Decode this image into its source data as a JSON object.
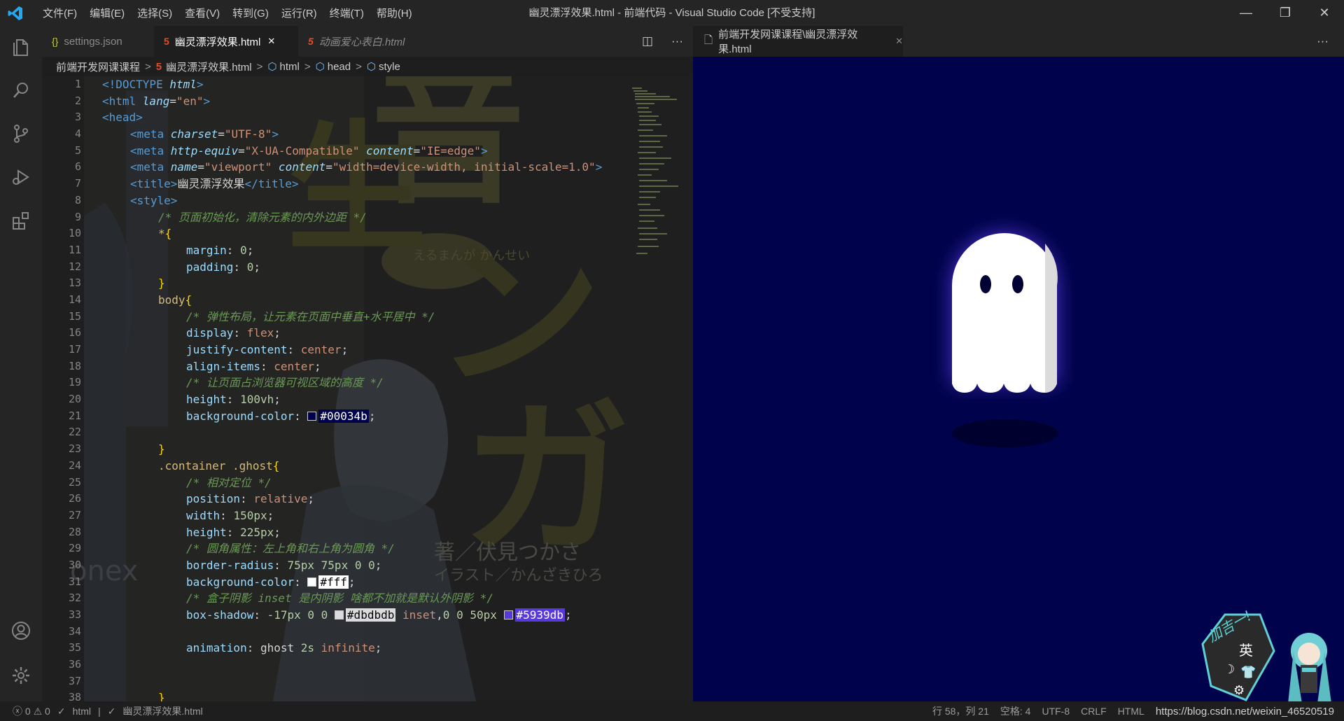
{
  "window": {
    "title": "幽灵漂浮效果.html - 前端代码 - Visual Studio Code [不受支持]",
    "controls": {
      "minimize": "—",
      "maximize": "❐",
      "close": "✕"
    }
  },
  "menu": [
    "文件(F)",
    "编辑(E)",
    "选择(S)",
    "查看(V)",
    "转到(G)",
    "运行(R)",
    "终端(T)",
    "帮助(H)"
  ],
  "activity_bar": [
    "files-icon",
    "search-icon",
    "source-control-icon",
    "run-debug-icon",
    "extensions-icon",
    "account-icon",
    "settings-gear-icon"
  ],
  "tabs": [
    {
      "label": "settings.json",
      "icon": "{}",
      "state": "inactive"
    },
    {
      "label": "幽灵漂浮效果.html",
      "icon": "5",
      "state": "active",
      "close": "✕"
    },
    {
      "label": "动画爱心表白.html",
      "icon": "5",
      "state": "inactive"
    }
  ],
  "tab_actions": {
    "split": "◫",
    "more": "···"
  },
  "breadcrumb": [
    "前端开发网课课程",
    "幽灵漂浮效果.html",
    "html",
    "head",
    "style"
  ],
  "line_numbers": [
    "1",
    "2",
    "3",
    "4",
    "5",
    "6",
    "7",
    "8",
    "9",
    "10",
    "11",
    "12",
    "13",
    "14",
    "15",
    "16",
    "17",
    "18",
    "19",
    "20",
    "21",
    "22",
    "23",
    "24",
    "25",
    "26",
    "27",
    "28",
    "29",
    "30",
    "31",
    "32",
    "33",
    "34",
    "35",
    "36",
    "37",
    "38"
  ],
  "code": {
    "l1_a": "<!DOCTYPE ",
    "l1_b": "html",
    "l1_c": ">",
    "l2_a": "<html ",
    "l2_b": "lang",
    "l2_c": "=",
    "l2_d": "\"en\"",
    "l2_e": ">",
    "l3": "<head>",
    "l4_a": "<meta ",
    "l4_b": "charset",
    "l4_c": "=",
    "l4_d": "\"UTF-8\"",
    "l4_e": ">",
    "l5_a": "<meta ",
    "l5_b": "http-equiv",
    "l5_c": "=",
    "l5_d": "\"X-UA-Compatible\"",
    "l5_e": " content",
    "l5_f": "=",
    "l5_g": "\"IE=edge\"",
    "l5_h": ">",
    "l6_a": "<meta ",
    "l6_b": "name",
    "l6_c": "=",
    "l6_d": "\"viewport\"",
    "l6_e": " content",
    "l6_f": "=",
    "l6_g": "\"width=device-width, initial-scale=1.0\"",
    "l6_h": ">",
    "l7_a": "<title>",
    "l7_b": "幽灵漂浮效果",
    "l7_c": "</title>",
    "l8": "<style>",
    "l9": "/* 页面初始化，清除元素的内外边距 */",
    "l10_a": "*",
    "l10_b": "{",
    "l11_a": "margin",
    "l11_b": ": ",
    "l11_c": "0",
    "l11_d": ";",
    "l12_a": "padding",
    "l12_b": ": ",
    "l12_c": "0",
    "l12_d": ";",
    "l13": "}",
    "l14_a": "body",
    "l14_b": "{",
    "l15": "/* 弹性布局，让元素在页面中垂直+水平居中 */",
    "l16_a": "display",
    "l16_b": ": ",
    "l16_c": "flex",
    "l16_d": ";",
    "l17_a": "justify-content",
    "l17_b": ": ",
    "l17_c": "center",
    "l17_d": ";",
    "l18_a": "align-items",
    "l18_b": ": ",
    "l18_c": "center",
    "l18_d": ";",
    "l19": "/* 让页面占浏览器可视区域的高度 */",
    "l20_a": "height",
    "l20_b": ": ",
    "l20_c": "100vh",
    "l20_d": ";",
    "l21_a": "background-color",
    "l21_b": ": ",
    "l21_c": "#00034b",
    "l21_d": ";",
    "l23": "}",
    "l24_a": ".container .ghost",
    "l24_b": "{",
    "l25": "/* 相对定位 */",
    "l26_a": "position",
    "l26_b": ": ",
    "l26_c": "relative",
    "l26_d": ";",
    "l27_a": "width",
    "l27_b": ": ",
    "l27_c": "150px",
    "l27_d": ";",
    "l28_a": "height",
    "l28_b": ": ",
    "l28_c": "225px",
    "l28_d": ";",
    "l29": "/* 圆角属性：左上角和右上角为圆角 */",
    "l30_a": "border-radius",
    "l30_b": ": ",
    "l30_c": "75px 75px 0 0",
    "l30_d": ";",
    "l31_a": "background-color",
    "l31_b": ": ",
    "l31_c": "#fff",
    "l31_d": ";",
    "l32": "/* 盒子阴影 inset 是内阴影 啥都不加就是默认外阴影 */",
    "l33_a": "box-shadow",
    "l33_b": ": ",
    "l33_c": "-17px 0 0 ",
    "l33_d": "#dbdbdb",
    "l33_e": " inset",
    "l33_f": ",",
    "l33_g": "0 0 50px ",
    "l33_h": "#5939db",
    "l33_i": ";",
    "l35_a": "animation",
    "l35_b": ": ",
    "l35_c": "ghost ",
    "l35_d": "2s ",
    "l35_e": "infinite",
    "l35_f": ";",
    "l38": "}"
  },
  "swatch_colors": {
    "bg": "#00034b",
    "ghost": "#ffffff",
    "shadow_inset": "#dbdbdb",
    "glow": "#5939db"
  },
  "background_art_text": {
    "big1": "音",
    "big2": "生",
    "kana1": "ン",
    "kana2": "ガ",
    "bubble": "えるまんが\nかんせい",
    "author1": "著／伏見つかさ",
    "author2": "イラスト／かんざきひろ",
    "brand": "onex"
  },
  "preview": {
    "tab_label": "前端开发网课课程\\幽灵漂浮效果.html",
    "more": "···",
    "bg_color": "#00034b"
  },
  "ime_widget": {
    "label1": "加吉一!",
    "lang": "英"
  },
  "status": {
    "errors": "0",
    "warnings": "0",
    "lang_check": "html",
    "file_check": "幽灵漂浮效果.html",
    "cursor": "行 58，列 21",
    "indent": "空格: 4",
    "encoding": "UTF-8",
    "eol": "CRLF",
    "mode": "HTML",
    "watermark": "https://blog.csdn.net/weixin_46520519"
  }
}
